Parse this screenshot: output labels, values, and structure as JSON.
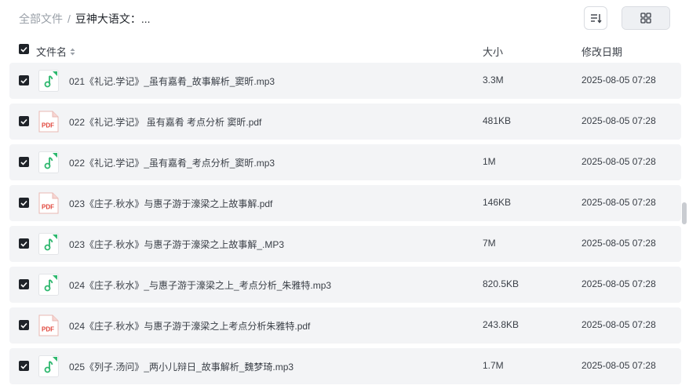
{
  "breadcrumb": {
    "root": "全部文件",
    "separator": "/",
    "current": "豆神大语文：..."
  },
  "toolbar": {
    "sort_icon": "sort-icon",
    "list_view_icon": "list-view-icon",
    "grid_view_icon": "grid-view-icon"
  },
  "table": {
    "headers": {
      "name": "文件名",
      "size": "大小",
      "modified": "修改日期"
    },
    "rows": [
      {
        "name": "021《礼记.学记》_虽有嘉肴_故事解析_窦昕.mp3",
        "size": "3.3M",
        "modified": "2025-08-05 07:28",
        "type": "audio"
      },
      {
        "name": "022《礼记.学记》 虽有嘉肴 考点分析 窦昕.pdf",
        "size": "481KB",
        "modified": "2025-08-05 07:28",
        "type": "pdf"
      },
      {
        "name": "022《礼记.学记》_虽有嘉肴_考点分析_窦昕.mp3",
        "size": "1M",
        "modified": "2025-08-05 07:28",
        "type": "audio"
      },
      {
        "name": "023《庄子.秋水》与惠子游于濠梁之上故事解.pdf",
        "size": "146KB",
        "modified": "2025-08-05 07:28",
        "type": "pdf"
      },
      {
        "name": "023《庄子.秋水》与惠子游于濠梁之上故事解_.MP3",
        "size": "7M",
        "modified": "2025-08-05 07:28",
        "type": "audio"
      },
      {
        "name": "024《庄子.秋水》_与惠子游于濠梁之上_考点分析_朱雅特.mp3",
        "size": "820.5KB",
        "modified": "2025-08-05 07:28",
        "type": "audio"
      },
      {
        "name": "024《庄子.秋水》与惠子游于濠梁之上考点分析朱雅特.pdf",
        "size": "243.8KB",
        "modified": "2025-08-05 07:28",
        "type": "pdf"
      },
      {
        "name": "025《列子.汤问》_两小儿辩日_故事解析_魏梦琦.mp3",
        "size": "1.7M",
        "modified": "2025-08-05 07:28",
        "type": "audio"
      }
    ]
  },
  "colors": {
    "audio_green": "#2fb86f",
    "pdf_red": "#e0443a",
    "row_bg": "#f3f4f6"
  },
  "icons": {
    "audio": "music-note-icon",
    "pdf": "pdf-file-icon",
    "check": "check-icon",
    "sort_indicator": "sort-indicator-icon"
  }
}
